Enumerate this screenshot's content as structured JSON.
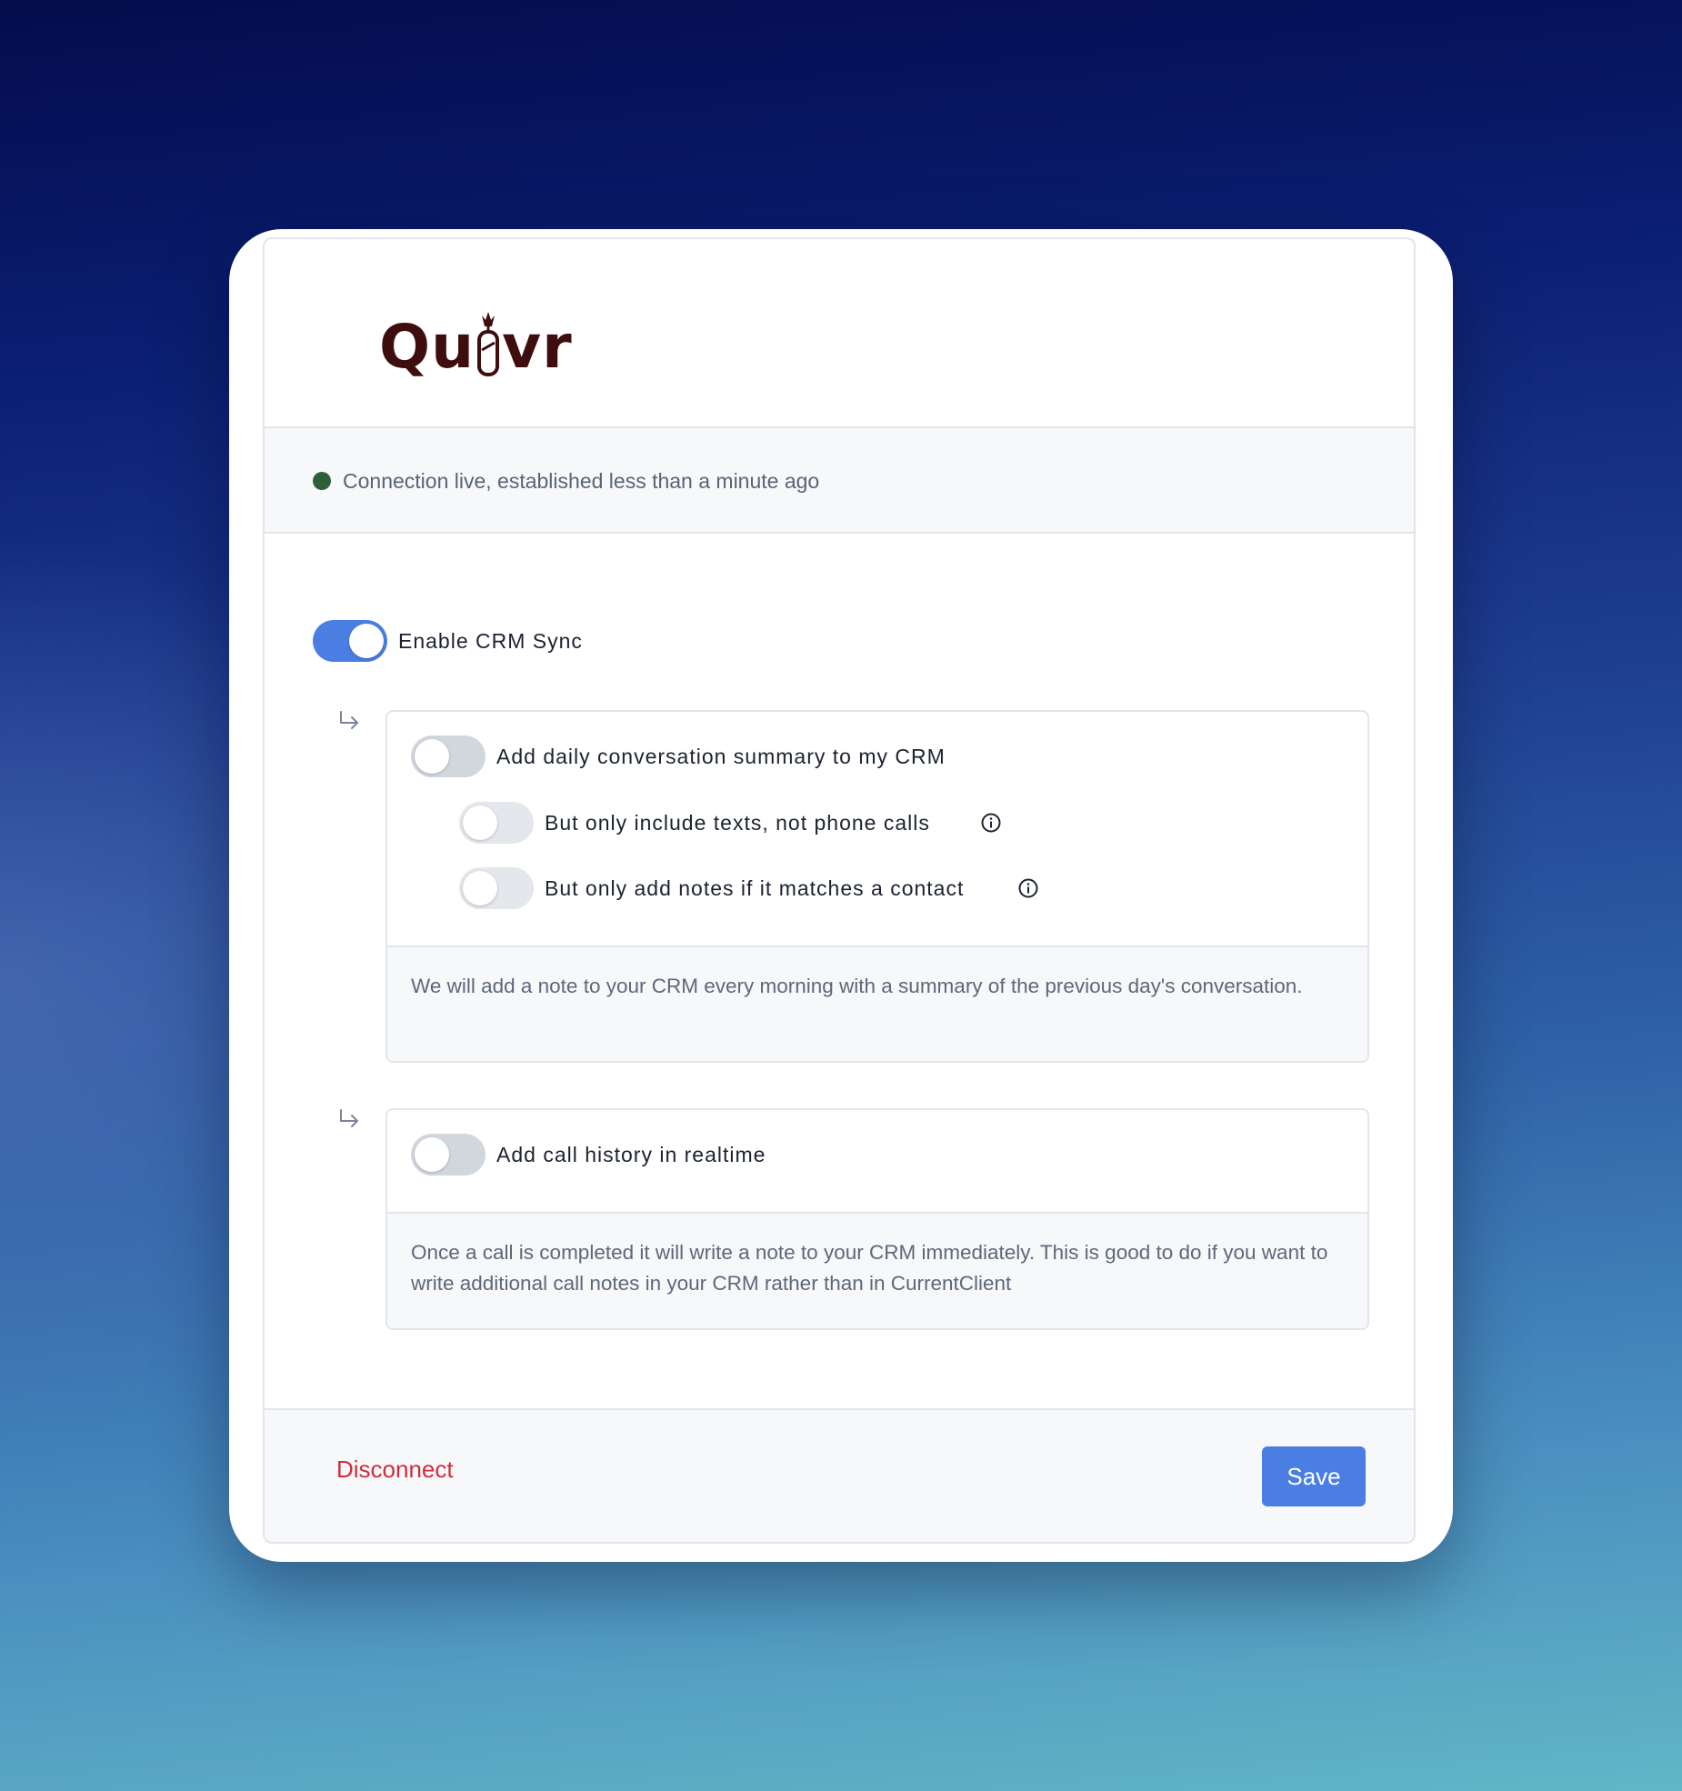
{
  "brand": {
    "logo_text_left": "Qu",
    "logo_text_right": "vr",
    "logo_color": "#3e0d0d"
  },
  "status": {
    "text": "Connection live, established less than a minute ago",
    "dot_color": "#2f5f38",
    "icon": "status-dot"
  },
  "crm_sync": {
    "label": "Enable CRM Sync",
    "enabled": true
  },
  "daily_summary": {
    "label": "Add daily conversation summary to my CRM",
    "enabled": false,
    "options": [
      {
        "label": "But only include texts, not phone calls",
        "enabled": false,
        "icon": "info-icon"
      },
      {
        "label": "But only add notes if it matches a contact",
        "enabled": false,
        "icon": "info-icon"
      }
    ],
    "description": "We will add a note to your CRM every morning with a summary of the previous day's conversation."
  },
  "call_history": {
    "label": "Add call history in realtime",
    "enabled": false,
    "description": "Once a call is completed it will write a note to your CRM immediately. This is good to do if you want to write additional call notes in your CRM rather than in CurrentClient"
  },
  "footer": {
    "disconnect_label": "Disconnect",
    "save_label": "Save"
  },
  "colors": {
    "accent": "#4a7ee3",
    "danger": "#cf2e3f",
    "panel_bg": "#f6f8fa"
  }
}
